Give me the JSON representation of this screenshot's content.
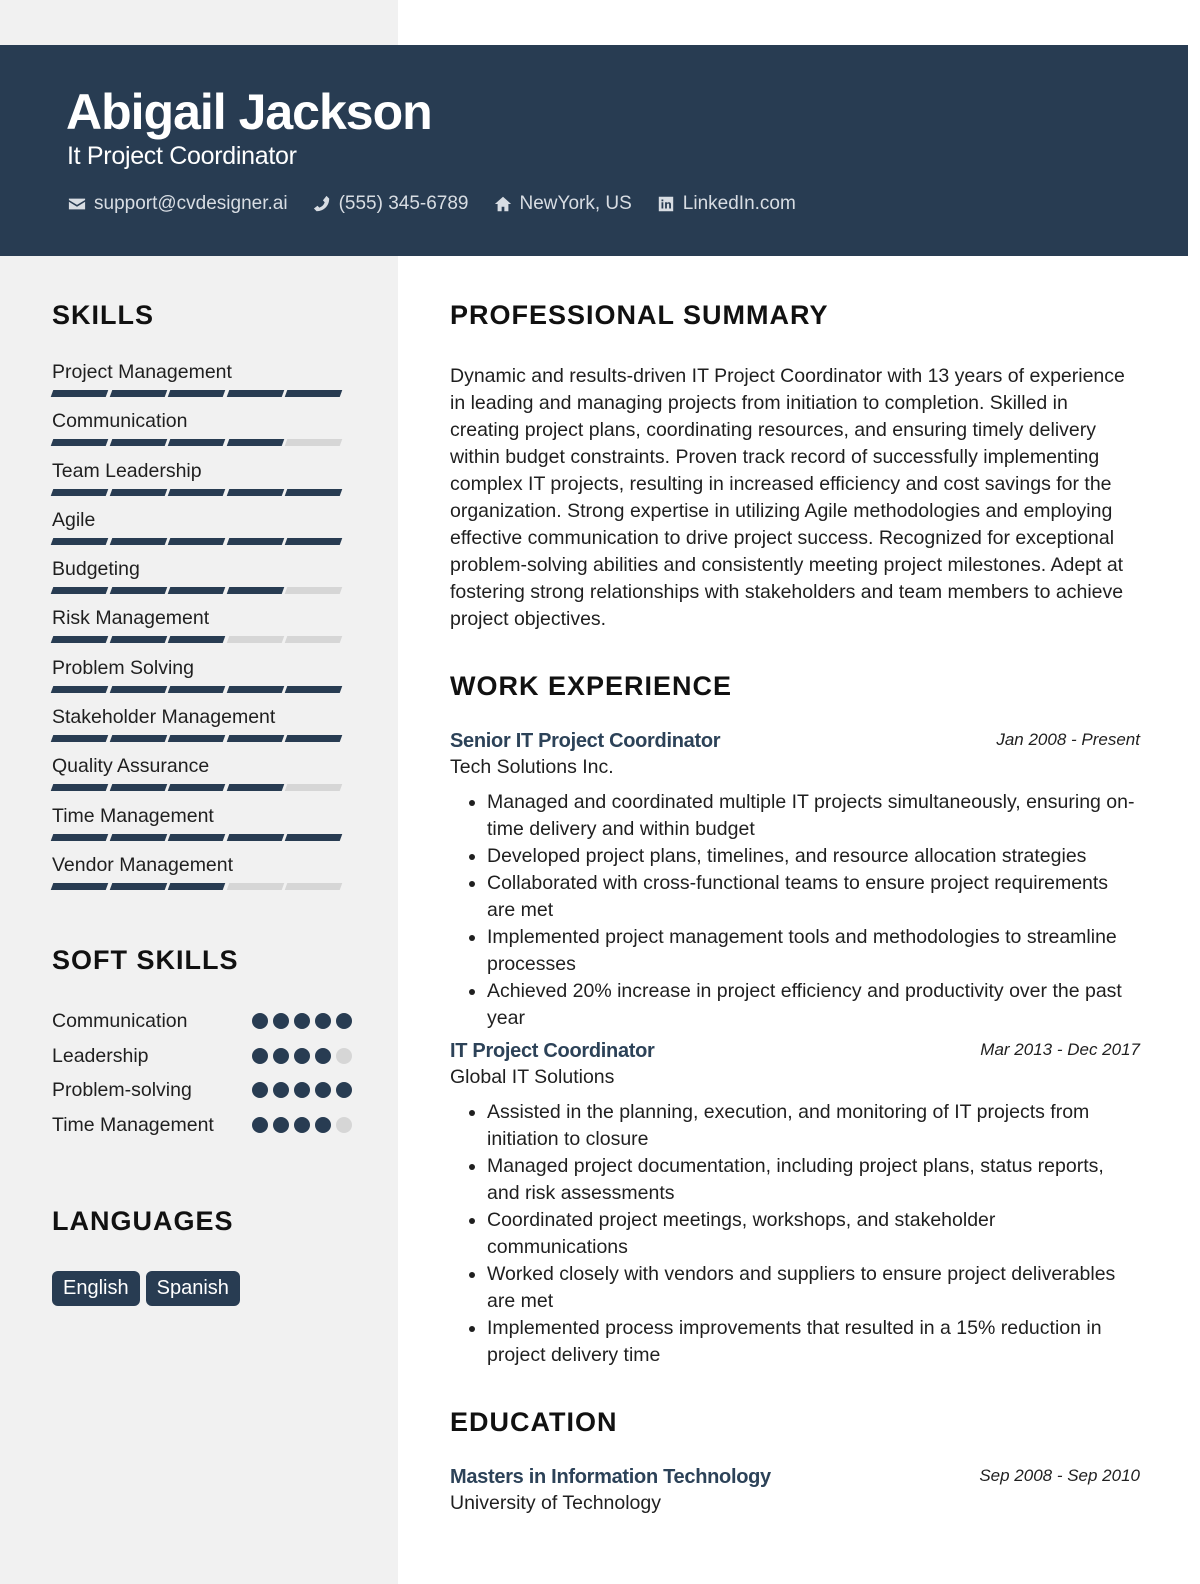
{
  "header": {
    "name": "Abigail Jackson",
    "title": "It Project Coordinator",
    "contacts": [
      {
        "icon": "envelope-icon",
        "text": "support@cvdesigner.ai"
      },
      {
        "icon": "phone-icon",
        "text": "(555) 345-6789"
      },
      {
        "icon": "home-icon",
        "text": "NewYork, US"
      },
      {
        "icon": "linkedin-icon",
        "text": "LinkedIn.com"
      }
    ]
  },
  "sidebar": {
    "skills": {
      "heading": "SKILLS",
      "items": [
        {
          "label": "Project Management",
          "level": 5,
          "max": 5
        },
        {
          "label": "Communication",
          "level": 4,
          "max": 5
        },
        {
          "label": "Team Leadership",
          "level": 5,
          "max": 5
        },
        {
          "label": "Agile",
          "level": 5,
          "max": 5
        },
        {
          "label": "Budgeting",
          "level": 4,
          "max": 5
        },
        {
          "label": "Risk Management",
          "level": 3,
          "max": 5
        },
        {
          "label": "Problem Solving",
          "level": 5,
          "max": 5
        },
        {
          "label": "Stakeholder Management",
          "level": 5,
          "max": 5
        },
        {
          "label": "Quality Assurance",
          "level": 4,
          "max": 5
        },
        {
          "label": "Time Management",
          "level": 5,
          "max": 5
        },
        {
          "label": "Vendor Management",
          "level": 3,
          "max": 5
        }
      ]
    },
    "soft_skills": {
      "heading": "SOFT SKILLS",
      "items": [
        {
          "label": "Communication",
          "level": 5,
          "max": 5
        },
        {
          "label": "Leadership",
          "level": 4,
          "max": 5
        },
        {
          "label": "Problem-solving",
          "level": 5,
          "max": 5
        },
        {
          "label": "Time Management",
          "level": 4,
          "max": 5
        }
      ]
    },
    "languages": {
      "heading": "LANGUAGES",
      "items": [
        "English",
        "Spanish"
      ]
    }
  },
  "main": {
    "summary": {
      "heading": "PROFESSIONAL SUMMARY",
      "text": "Dynamic and results-driven IT Project Coordinator with 13 years of experience in leading and managing projects from initiation to completion. Skilled in creating project plans, coordinating resources, and ensuring timely delivery within budget constraints. Proven track record of successfully implementing complex IT projects, resulting in increased efficiency and cost savings for the organization. Strong expertise in utilizing Agile methodologies and employing effective communication to drive project success. Recognized for exceptional problem-solving abilities and consistently meeting project milestones. Adept at fostering strong relationships with stakeholders and team members to achieve project objectives."
    },
    "experience": {
      "heading": "WORK EXPERIENCE",
      "jobs": [
        {
          "title": "Senior IT Project Coordinator",
          "dates": "Jan 2008 - Present",
          "company": "Tech Solutions Inc.",
          "bullets": [
            "Managed and coordinated multiple IT projects simultaneously, ensuring on-time delivery and within budget",
            "Developed project plans, timelines, and resource allocation strategies",
            "Collaborated with cross-functional teams to ensure project requirements are met",
            "Implemented project management tools and methodologies to streamline processes",
            "Achieved 20% increase in project efficiency and productivity over the past year"
          ]
        },
        {
          "title": "IT Project Coordinator",
          "dates": "Mar 2013 - Dec 2017",
          "company": "Global IT Solutions",
          "bullets": [
            "Assisted in the planning, execution, and monitoring of IT projects from initiation to closure",
            "Managed project documentation, including project plans, status reports, and risk assessments",
            "Coordinated project meetings, workshops, and stakeholder communications",
            "Worked closely with vendors and suppliers to ensure project deliverables are met",
            "Implemented process improvements that resulted in a 15% reduction in project delivery time"
          ]
        }
      ]
    },
    "education": {
      "heading": "EDUCATION",
      "items": [
        {
          "degree": "Masters in Information Technology",
          "dates": "Sep 2008 - Sep 2010",
          "school": "University of Technology"
        }
      ]
    }
  },
  "colors": {
    "primary": "#283c52",
    "sidebar_bg": "#f1f1f1",
    "inactive": "#d6d6d6",
    "job_title": "#2c4258"
  }
}
